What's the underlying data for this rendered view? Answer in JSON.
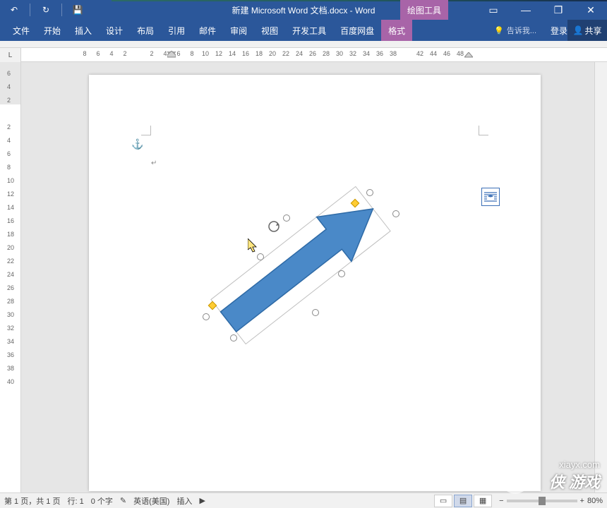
{
  "title": "新建 Microsoft Word 文档.docx - Word",
  "context_tab": "绘图工具",
  "qat": {
    "undo": "↶",
    "redo": "↻",
    "save": "💾"
  },
  "win": {
    "ribbon": "▭",
    "min": "—",
    "restore": "❐",
    "close": "✕"
  },
  "tabs": [
    "文件",
    "开始",
    "插入",
    "设计",
    "布局",
    "引用",
    "邮件",
    "审阅",
    "视图",
    "开发工具",
    "百度网盘"
  ],
  "active_tab": "格式",
  "tell_me": "告诉我...",
  "login": "登录",
  "share": "共享",
  "ruler_corner": "L",
  "ruler_h": [
    8,
    6,
    4,
    2,
    "",
    2,
    4,
    6,
    8,
    10,
    12,
    14,
    16,
    18,
    20,
    22,
    24,
    26,
    28,
    30,
    32,
    34,
    36,
    38,
    "",
    42,
    44,
    46,
    48
  ],
  "ruler_v": [
    6,
    4,
    2,
    "",
    2,
    4,
    6,
    8,
    10,
    12,
    14,
    16,
    18,
    20,
    22,
    24,
    26,
    28,
    30,
    32,
    34,
    36,
    38,
    40
  ],
  "status": {
    "page": "第 1 页，共 1 页",
    "line": "行: 1",
    "words": "0 个字",
    "lang": "英语(美国)",
    "insert": "插入",
    "zoom": "80%"
  },
  "watermark": {
    "url": "xiayx.com",
    "brand": "侠  游戏"
  },
  "chart_data": {
    "type": "diagram",
    "shapes": [
      {
        "kind": "right-arrow",
        "fill": "#4a89c8",
        "stroke": "#2e6aa6",
        "rotation_deg": -30,
        "selected": true,
        "handles": {
          "resize": 8,
          "adjust": 2,
          "rotate": 1
        }
      }
    ]
  }
}
